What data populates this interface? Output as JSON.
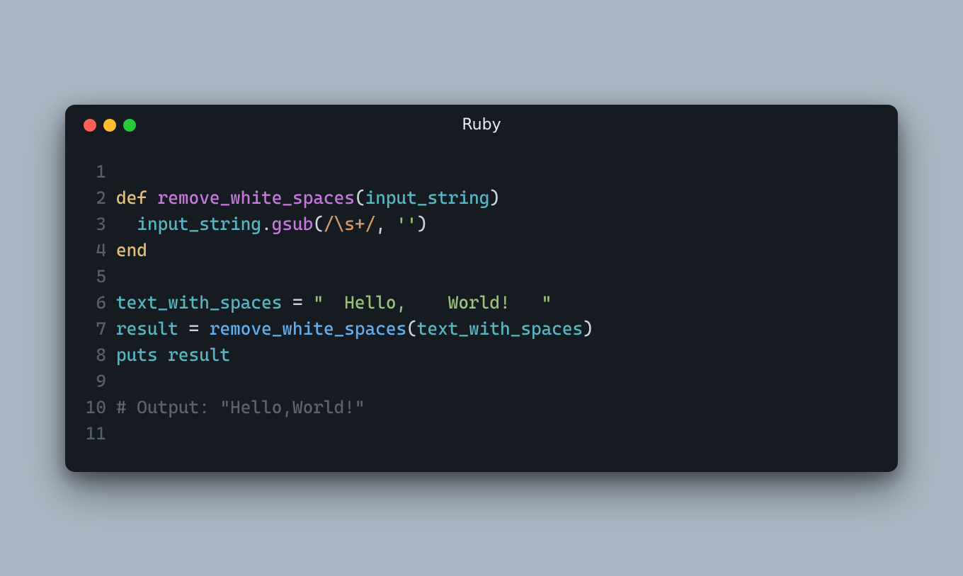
{
  "window": {
    "title": "Ruby",
    "traffic": [
      "red",
      "yellow",
      "green"
    ]
  },
  "code": {
    "line_count": 11,
    "lines": {
      "l2_def": "def",
      "l2_sp1": " ",
      "l2_fn": "remove_white_spaces",
      "l2_open": "(",
      "l2_arg": "input_string",
      "l2_close": ")",
      "l3_indent": "  ",
      "l3_recv": "input_string",
      "l3_dot": ".",
      "l3_gsub": "gsub",
      "l3_open": "(",
      "l3_rgx": "/\\s+/",
      "l3_comma": ", ",
      "l3_str": "''",
      "l3_close": ")",
      "l4_end": "end",
      "l6_var": "text_with_spaces",
      "l6_eq": " = ",
      "l6_str": "\"  Hello,    World!   \"",
      "l7_var": "result",
      "l7_eq": " = ",
      "l7_fn": "remove_white_spaces",
      "l7_open": "(",
      "l7_arg": "text_with_spaces",
      "l7_close": ")",
      "l8_puts": "puts",
      "l8_sp": " ",
      "l8_arg": "result",
      "l10_cmt": "# Output: \"Hello,World!\""
    },
    "gutter": {
      "n1": "1",
      "n2": "2",
      "n3": "3",
      "n4": "4",
      "n5": "5",
      "n6": "6",
      "n7": "7",
      "n8": "8",
      "n9": "9",
      "n10": "10",
      "n11": "11"
    }
  }
}
